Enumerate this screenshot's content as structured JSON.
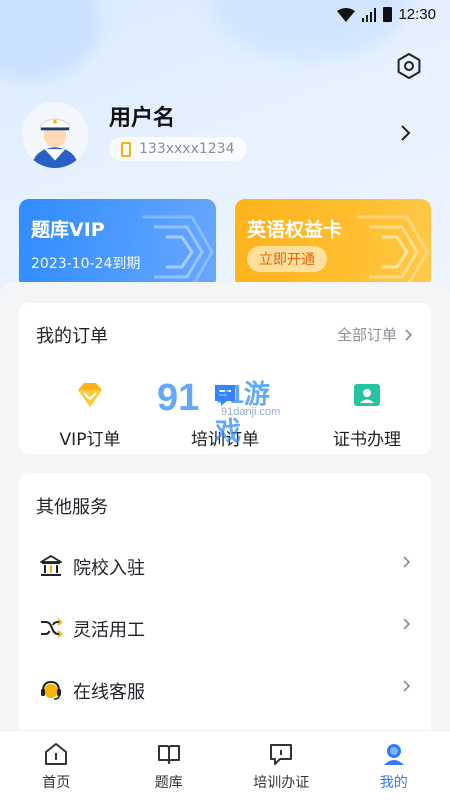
{
  "status_bar": {
    "time": "12:30"
  },
  "profile": {
    "username": "用户名",
    "phone": "133xxxx1234"
  },
  "cards": {
    "vip": {
      "title": "题库VIP",
      "expiry": "2023-10-24到期"
    },
    "english": {
      "title": "英语权益卡",
      "button": "立即开通"
    }
  },
  "orders": {
    "title": "我的订单",
    "all_label": "全部订单",
    "items": [
      {
        "label": "VIP订单",
        "icon": "diamond-icon"
      },
      {
        "label": "培训订单",
        "icon": "training-icon"
      },
      {
        "label": "证书办理",
        "icon": "certificate-icon"
      }
    ]
  },
  "watermark": {
    "brand": "91游戏",
    "url": "91danji.com"
  },
  "services": {
    "title": "其他服务",
    "items": [
      {
        "label": "院校入驻",
        "icon": "school-icon"
      },
      {
        "label": "灵活用工",
        "icon": "shuffle-icon"
      },
      {
        "label": "在线客服",
        "icon": "headset-icon"
      }
    ]
  },
  "tabbar": {
    "items": [
      {
        "label": "首页",
        "icon": "home-icon"
      },
      {
        "label": "题库",
        "icon": "book-icon"
      },
      {
        "label": "培训办证",
        "icon": "chat-icon"
      },
      {
        "label": "我的",
        "icon": "profile-icon"
      }
    ],
    "active_index": 3
  },
  "colors": {
    "accent": "#2f7bff",
    "vip_card": "#3a90ff",
    "english_card": "#ffb820",
    "phone_icon": "#f5b400"
  }
}
